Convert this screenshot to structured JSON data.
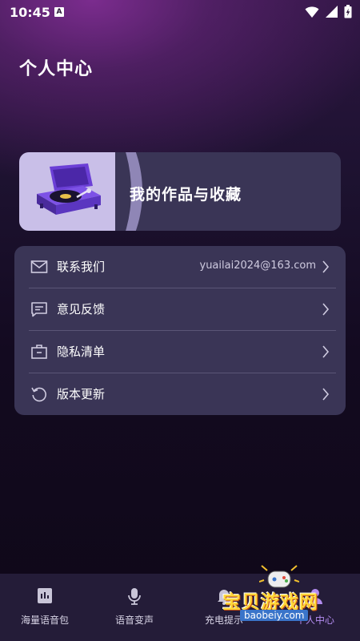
{
  "status_bar": {
    "time": "10:45",
    "notification_badge": "A"
  },
  "page": {
    "title": "个人中心"
  },
  "works_card": {
    "title": "我的作品与收藏"
  },
  "menu": {
    "items": [
      {
        "icon": "mail-icon",
        "label": "联系我们",
        "value": "yuailai2024@163.com"
      },
      {
        "icon": "feedback-icon",
        "label": "意见反馈",
        "value": ""
      },
      {
        "icon": "briefcase-icon",
        "label": "隐私清单",
        "value": ""
      },
      {
        "icon": "refresh-icon",
        "label": "版本更新",
        "value": ""
      }
    ]
  },
  "bottom_nav": {
    "tabs": [
      {
        "icon": "voice-pack-icon",
        "label": "海量语音包"
      },
      {
        "icon": "microphone-icon",
        "label": "语音变声"
      },
      {
        "icon": "bell-icon",
        "label": "充电提示"
      },
      {
        "icon": "profile-icon",
        "label": "个人中心"
      }
    ],
    "active_index": 3
  },
  "watermark": {
    "title": "宝贝游戏网",
    "url": "baobeiy.com"
  },
  "colors": {
    "accent": "#b38cf0",
    "card": "#3a3556",
    "nav": "#241c38",
    "watermark": "#ffd83a"
  }
}
